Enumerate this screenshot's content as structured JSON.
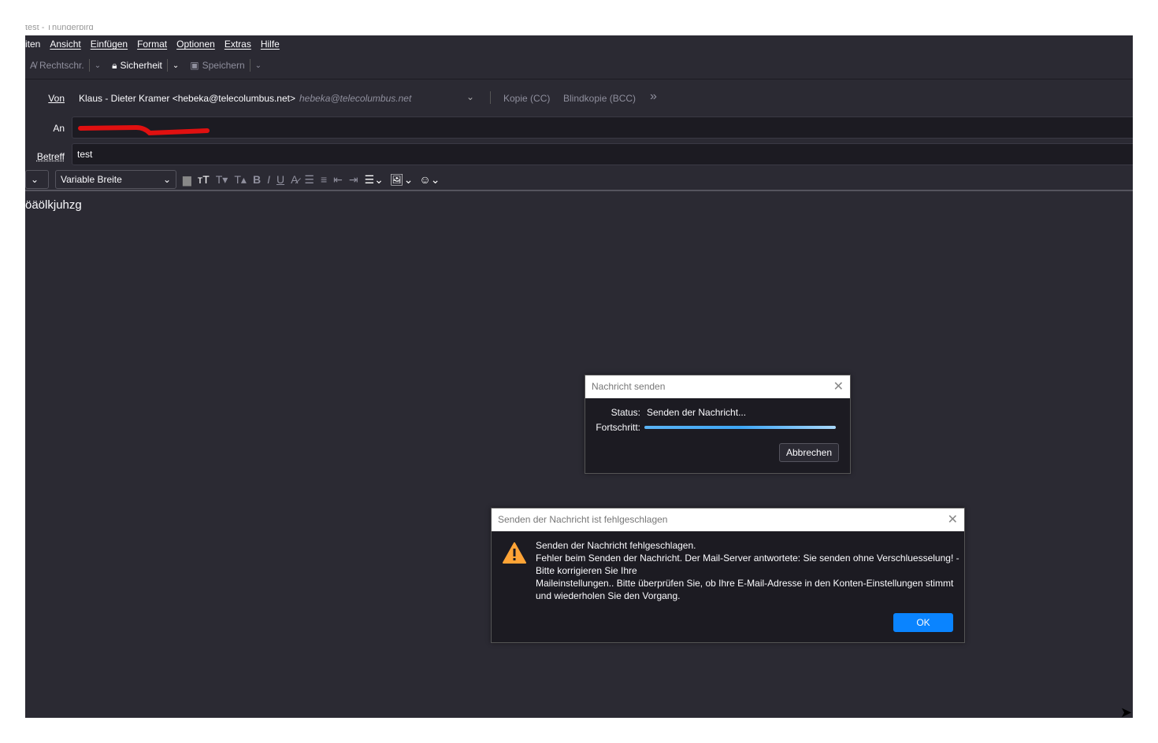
{
  "window": {
    "title": "test - Thunderbird"
  },
  "menu": [
    "iten",
    "Ansicht",
    "Einfügen",
    "Format",
    "Optionen",
    "Extras",
    "Hilfe"
  ],
  "toolbar": {
    "spelling": "Rechtschr.",
    "security": "Sicherheit",
    "save": "Speichern"
  },
  "header": {
    "from_label": "Von",
    "from_value": "Klaus - Dieter Kramer <hebeka@telecolumbus.net>",
    "from_identity": "hebeka@telecolumbus.net",
    "cc": "Kopie (CC)",
    "bcc": "Blindkopie (BCC)",
    "to_label": "An",
    "subject_label": "Betreff",
    "subject_value": "test"
  },
  "format": {
    "font": "Variable Breite"
  },
  "body_text": "öäölkjuhzg",
  "send_dialog": {
    "title": "Nachricht senden",
    "status_label": "Status:",
    "status_value": "Senden der Nachricht...",
    "progress_label": "Fortschritt:",
    "progress": 1.0,
    "cancel": "Abbrechen"
  },
  "error_dialog": {
    "title": "Senden der Nachricht ist fehlgeschlagen",
    "lines": [
      "Senden der Nachricht fehlgeschlagen.",
      "Fehler beim Senden der Nachricht. Der Mail-Server antwortete: Sie senden ohne Verschluesselung! -",
      "Bitte korrigieren Sie Ihre",
      "Maileinstellungen.. Bitte überprüfen Sie, ob Ihre E-Mail-Adresse in den Konten-Einstellungen stimmt",
      "und wiederholen Sie den Vorgang."
    ],
    "ok": "OK",
    "accent": "#0a84ff",
    "warning_color": "#ffa436"
  }
}
